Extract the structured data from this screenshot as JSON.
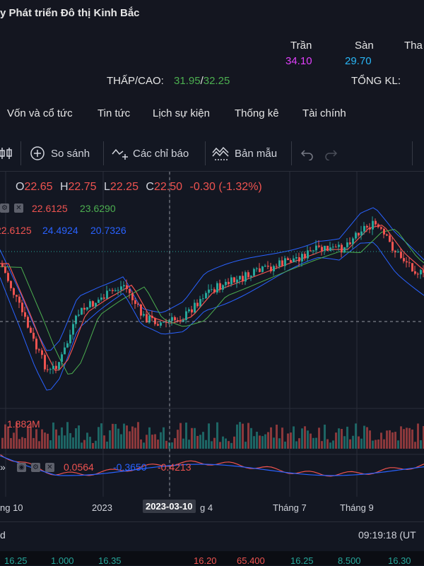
{
  "company": {
    "name": "y Phát triển Đô thị Kinh Bắc"
  },
  "prices": {
    "ceiling_label": "Trần",
    "ceiling_value": "34.10",
    "floor_label": "Sàn",
    "floor_value": "29.70",
    "ref_label": "Tha",
    "low_high_label": "THẤP/CAO:",
    "low_value": "31.95",
    "high_value": "32.25",
    "total_vol_label": "TỔNG KL:"
  },
  "tabs": [
    "Vốn và cổ tức",
    "Tin tức",
    "Lịch sự kiện",
    "Thống kê",
    "Tài chính"
  ],
  "toolbar": {
    "compare": "So sánh",
    "indicators": "Các chỉ báo",
    "templates": "Bản mẫu"
  },
  "legend": {
    "o_label": "O",
    "o": "22.65",
    "h_label": "H",
    "h": "22.75",
    "l_label": "L",
    "l": "22.25",
    "c_label": "C",
    "c": "22.50",
    "change": "-0.30 (-1.32%)",
    "ma1": "22.6125",
    "ma2": "23.6290",
    "bb_mid": "22.6125",
    "bb_up": "24.4924",
    "bb_low": "20.7326",
    "volume": "1.882M",
    "macd1": "0.0564",
    "macd2": "-0.3650",
    "macd3": "-0.4213"
  },
  "xaxis": {
    "labels": [
      "ng 10",
      "2023",
      "g 4",
      "Tháng 7",
      "Tháng 9"
    ],
    "cursor": "2023-03-10"
  },
  "status": {
    "left": "d",
    "time": "09:19:18 (UT"
  },
  "ticker": [
    "16.25",
    "1.000",
    "16.35",
    "16.20",
    "65.400",
    "16.25",
    "8.500",
    "16.30"
  ],
  "colors": {
    "up": "#26a69a",
    "down": "#ef5350",
    "ceiling": "#e040fb",
    "floor": "#29b6f6",
    "green": "#4caf50",
    "blue": "#2962ff"
  }
}
